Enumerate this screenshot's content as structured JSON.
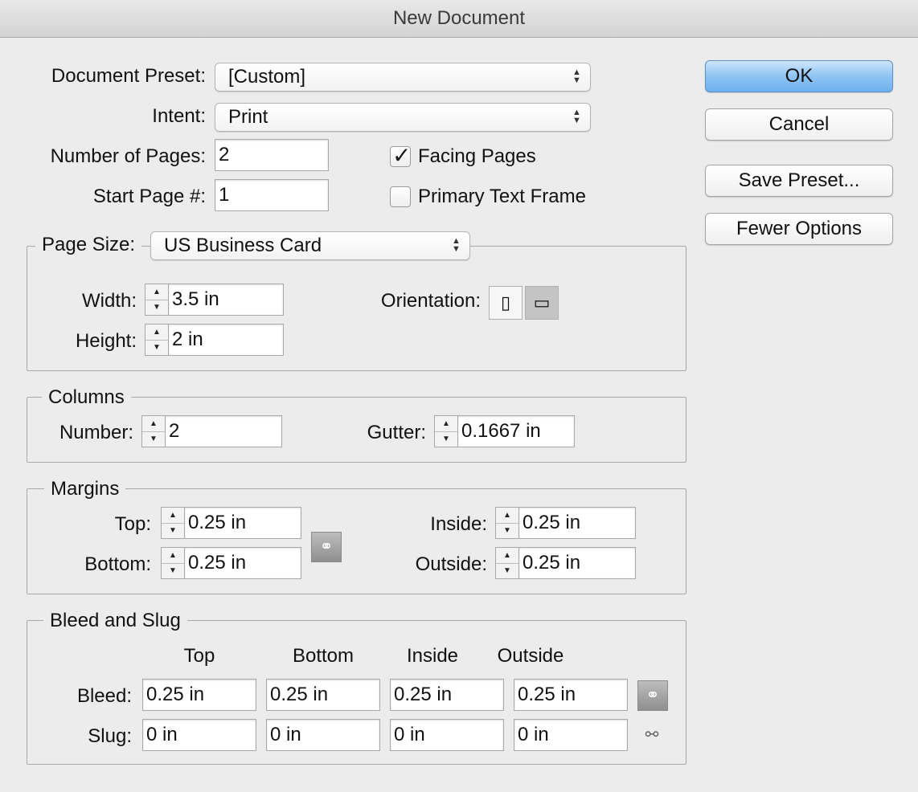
{
  "window": {
    "title": "New Document"
  },
  "document": {
    "preset_label": "Document Preset:",
    "preset_value": "[Custom]",
    "intent_label": "Intent:",
    "intent_value": "Print",
    "pages_label": "Number of Pages:",
    "pages_value": "2",
    "start_label": "Start Page #:",
    "start_value": "1",
    "facing_label": "Facing Pages",
    "facing_checked": true,
    "primary_label": "Primary Text Frame",
    "primary_checked": false
  },
  "buttons": {
    "ok": "OK",
    "cancel": "Cancel",
    "save_preset": "Save Preset...",
    "fewer_options": "Fewer Options"
  },
  "page_size": {
    "label": "Page Size:",
    "value": "US Business Card",
    "width_label": "Width:",
    "width_value": "3.5 in",
    "height_label": "Height:",
    "height_value": "2 in",
    "orientation_label": "Orientation:",
    "orientation_selected": "landscape"
  },
  "columns": {
    "title": "Columns",
    "number_label": "Number:",
    "number_value": "2",
    "gutter_label": "Gutter:",
    "gutter_value": "0.1667 in"
  },
  "margins": {
    "title": "Margins",
    "top_label": "Top:",
    "top_value": "0.25 in",
    "bottom_label": "Bottom:",
    "bottom_value": "0.25 in",
    "inside_label": "Inside:",
    "inside_value": "0.25 in",
    "outside_label": "Outside:",
    "outside_value": "0.25 in"
  },
  "bleed_slug": {
    "title": "Bleed and Slug",
    "headers": [
      "Top",
      "Bottom",
      "Inside",
      "Outside"
    ],
    "bleed_label": "Bleed:",
    "bleed_values": [
      "0.25 in",
      "0.25 in",
      "0.25 in",
      "0.25 in"
    ],
    "slug_label": "Slug:",
    "slug_values": [
      "0 in",
      "0 in",
      "0 in",
      "0 in"
    ]
  }
}
